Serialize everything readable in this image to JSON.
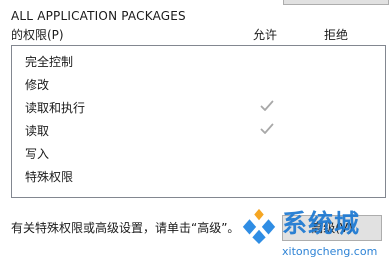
{
  "security": {
    "group_name": "ALL APPLICATION PACKAGES",
    "permissions_title": "的权限(P)",
    "columns": {
      "allow": "允许",
      "deny": "拒绝"
    },
    "permissions": [
      {
        "label": "完全控制",
        "allow": false,
        "deny": false
      },
      {
        "label": "修改",
        "allow": false,
        "deny": false
      },
      {
        "label": "读取和执行",
        "allow": true,
        "deny": false
      },
      {
        "label": "读取",
        "allow": true,
        "deny": false
      },
      {
        "label": "写入",
        "allow": false,
        "deny": false
      },
      {
        "label": "特殊权限",
        "allow": false,
        "deny": false
      }
    ],
    "footer_note": "有关特殊权限或高级设置，请单击“高级”。",
    "advanced_button": "高级(V)"
  },
  "watermark": {
    "title": "系统城",
    "url": "xitongcheng.com"
  },
  "colors": {
    "check_mark": "#a8a8a8",
    "watermark_blue": "#1b78d2"
  }
}
